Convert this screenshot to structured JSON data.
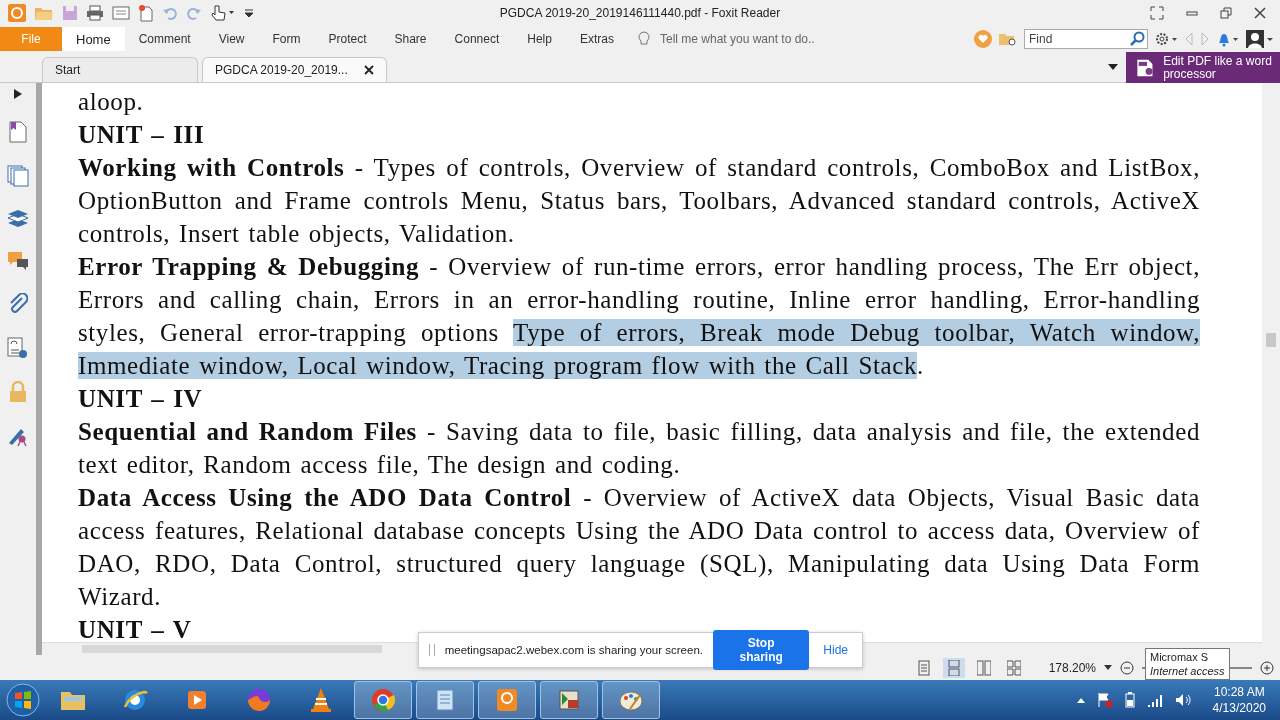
{
  "window": {
    "title": "PGDCA  2019-20_2019146111440.pdf - Foxit Reader"
  },
  "ribbon": {
    "file_label": "File",
    "tabs": [
      {
        "label": "Home",
        "selected": true
      },
      {
        "label": "Comment",
        "selected": false
      },
      {
        "label": "View",
        "selected": false
      },
      {
        "label": "Form",
        "selected": false
      },
      {
        "label": "Protect",
        "selected": false
      },
      {
        "label": "Share",
        "selected": false
      },
      {
        "label": "Connect",
        "selected": false
      },
      {
        "label": "Help",
        "selected": false
      },
      {
        "label": "Extras",
        "selected": false
      }
    ],
    "tell_me": {
      "placeholder": "Tell me what you want to do.."
    },
    "find": {
      "placeholder": "Find"
    }
  },
  "doc_tabs": [
    {
      "label": "Start",
      "selected": false,
      "closable": false
    },
    {
      "label": "PGDCA  2019-20_2019...",
      "selected": true,
      "closable": true
    }
  ],
  "ad_banner": {
    "text": "Edit PDF like a word processor"
  },
  "document": {
    "paragraphs": [
      {
        "kind": "paragraph",
        "segments": [
          {
            "text": "aloop.",
            "bold": false,
            "highlighted": false
          }
        ]
      },
      {
        "kind": "heading",
        "text": "UNIT – III"
      },
      {
        "kind": "paragraph",
        "segments": [
          {
            "text": "Working with Controls",
            "bold": true,
            "highlighted": false
          },
          {
            "text": " - Types of controls, Overview of standard controls, ComboBox and ListBox, OptionButton and Frame controls Menu, Status bars, Toolbars, Advanced standard controls, ActiveX controls, Insert table objects, Validation.",
            "bold": false,
            "highlighted": false
          }
        ]
      },
      {
        "kind": "paragraph",
        "segments": [
          {
            "text": "Error Trapping & Debugging",
            "bold": true,
            "highlighted": false
          },
          {
            "text": " - Overview of run-time errors, error handling process, The Err object, Errors and calling chain, Errors in an error-handling routine, Inline error handling, Error-handling styles, General error-trapping options ",
            "bold": false,
            "highlighted": false
          },
          {
            "text": "Type of errors, Break mode Debug toolbar, Watch window, Immediate window, Local window, Tracing program flow with the Call Stack",
            "bold": false,
            "highlighted": true
          },
          {
            "text": ".",
            "bold": false,
            "highlighted": false
          }
        ]
      },
      {
        "kind": "heading",
        "text": "UNIT – IV"
      },
      {
        "kind": "paragraph",
        "segments": [
          {
            "text": "Sequential and Random Files",
            "bold": true,
            "highlighted": false
          },
          {
            "text": " - Saving data to file, basic filling, data analysis and file, the extended text editor, Random access file, The design and coding.",
            "bold": false,
            "highlighted": false
          }
        ]
      },
      {
        "kind": "paragraph",
        "segments": [
          {
            "text": "Data Access Using the ADO Data Control",
            "bold": true,
            "highlighted": false
          },
          {
            "text": " - Overview of ActiveX data Objects, Visual Basic data access features, Relational database concepts Using the ADO Data control to access data, Overview of DAO, RDO, Data Control, structured query language (SQL), Manipulating data Using Data Form Wizard.",
            "bold": false,
            "highlighted": false
          }
        ]
      },
      {
        "kind": "heading",
        "text": "UNIT – V"
      }
    ]
  },
  "status_bar": {
    "view_modes": [
      {
        "kind": "single",
        "selected": false
      },
      {
        "kind": "continuous",
        "selected": true
      },
      {
        "kind": "facing",
        "selected": false
      },
      {
        "kind": "continuous-facing",
        "selected": false
      }
    ],
    "zoom": "178.20%"
  },
  "share_bar": {
    "message": "meetingsapac2.webex.com is sharing your screen.",
    "stop_button": "Stop sharing",
    "hide_link": "Hide"
  },
  "tooltip": {
    "title": "Micromax S",
    "subtitle": "Internet access"
  },
  "taskbar": {
    "apps": [
      {
        "kind": "folder",
        "open": false
      },
      {
        "kind": "browser-e",
        "open": false
      },
      {
        "kind": "media",
        "open": false
      },
      {
        "kind": "fox",
        "open": false
      },
      {
        "kind": "cone",
        "open": false
      },
      {
        "kind": "chrome",
        "open": true
      },
      {
        "kind": "notepad",
        "open": true
      },
      {
        "kind": "pdf",
        "open": true
      },
      {
        "kind": "app32",
        "open": true
      },
      {
        "kind": "paint",
        "open": true
      }
    ],
    "clock": {
      "time": "10:28 AM",
      "date": "4/13/2020"
    }
  }
}
